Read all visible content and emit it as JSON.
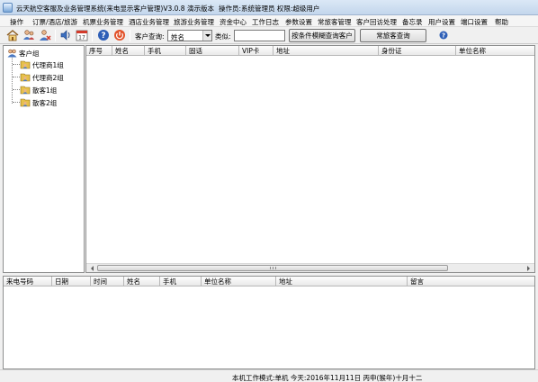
{
  "window": {
    "title": "云天航空客服及业务管理系统(来电显示客户管理)V3.0.8 演示版本",
    "operator_info": "操作员:系统管理员  权限:超级用户"
  },
  "menu": [
    {
      "label": "操作"
    },
    {
      "label": "订票/酒店/旅游"
    },
    {
      "label": "机票业务管理"
    },
    {
      "label": "酒店业务管理"
    },
    {
      "label": "旅游业务管理"
    },
    {
      "label": "资金中心"
    },
    {
      "label": "工作日志"
    },
    {
      "label": "参数设置"
    },
    {
      "label": "常旅客管理"
    },
    {
      "label": "客户回访处理"
    },
    {
      "label": "备忘录"
    },
    {
      "label": "用户设置"
    },
    {
      "label": "端口设置"
    },
    {
      "label": "帮助"
    }
  ],
  "toolbar": {
    "icons": [
      "add-customer-icon",
      "edit-customer-icon",
      "delete-customer-icon",
      "speaker-icon",
      "calendar-icon",
      "help-icon",
      "exit-icon"
    ],
    "calendar_number": "17",
    "query_label": "客户查询:",
    "query_field_value": "姓名",
    "fuzzy_label": "类似:",
    "fuzzy_value": "",
    "btn_fuzzy_query": "按条件模糊查询客户",
    "btn_frequent_query": "常旅客查询"
  },
  "tree": {
    "root": "客户组",
    "groups": [
      "代理商1组",
      "代理商2组",
      "散客1组",
      "散客2组"
    ]
  },
  "customer_grid": {
    "columns": [
      "序号",
      "姓名",
      "手机",
      "固话",
      "VIP卡",
      "地址",
      "身份证",
      "单位名称"
    ],
    "rows": []
  },
  "call_grid": {
    "columns": [
      "来电号码",
      "日期",
      "时间",
      "姓名",
      "手机",
      "单位名称",
      "地址",
      "留言"
    ],
    "rows": []
  },
  "status": {
    "text": "本机工作模式:单机   今天:2016年11月11日 丙申(猴年)十月十二"
  },
  "colors": {
    "titlebar": "#c3d6ec",
    "window_bg": "#f0f0f0",
    "grid_border": "#8e8f8f",
    "folder_yellow": "#e7c14a",
    "help_blue": "#2e5fb7",
    "exit_orange": "#e2522a"
  }
}
